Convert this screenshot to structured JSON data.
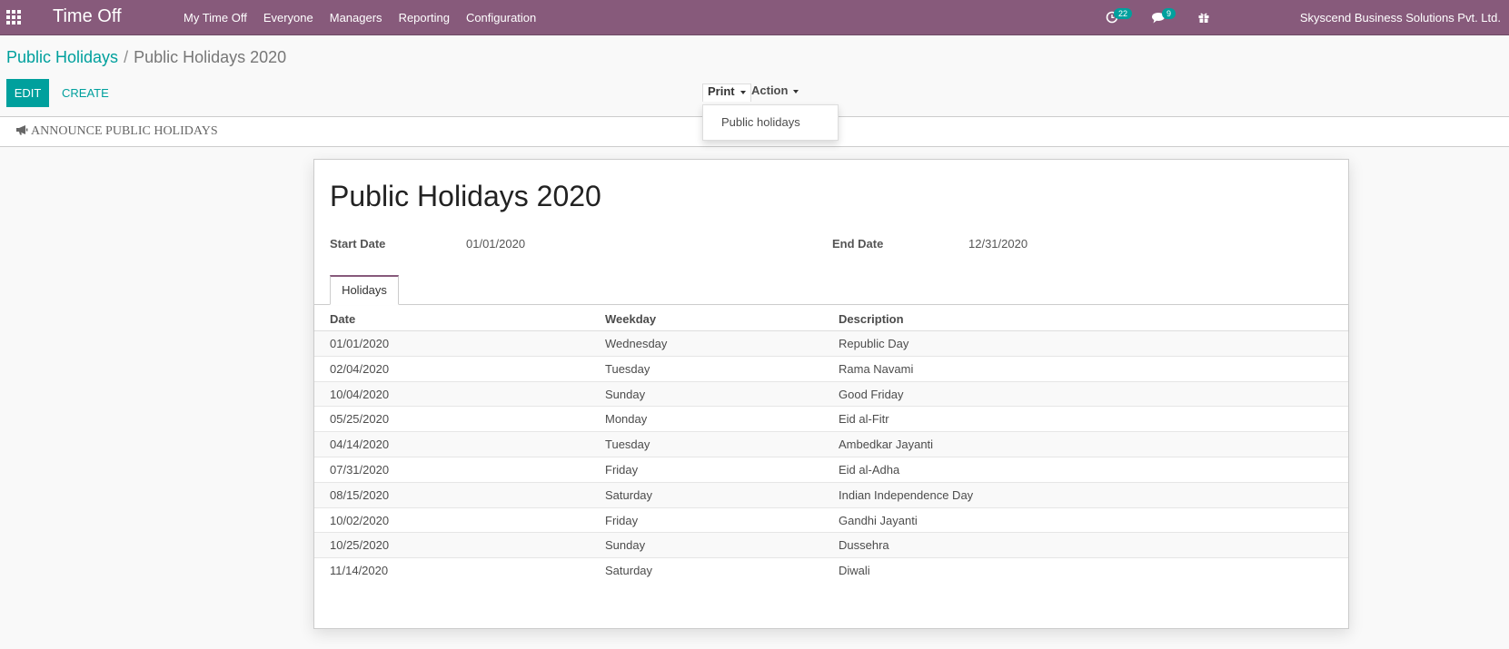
{
  "navbar": {
    "app_title": "Time Off",
    "menu": [
      "My Time Off",
      "Everyone",
      "Managers",
      "Reporting",
      "Configuration"
    ],
    "activity_count": "22",
    "messages_count": "9",
    "company": "Skyscend Business Solutions Pvt. Ltd."
  },
  "breadcrumb": {
    "parent": "Public Holidays",
    "separator": "/",
    "current": "Public Holidays 2020"
  },
  "buttons": {
    "edit": "EDIT",
    "create": "CREATE",
    "print": "Print",
    "action": "Action"
  },
  "print_menu": {
    "items": [
      "Public holidays"
    ]
  },
  "statusbar": {
    "announce": "ANNOUNCE PUBLIC HOLIDAYS"
  },
  "form": {
    "title": "Public Holidays 2020",
    "start_date_label": "Start Date",
    "start_date": "01/01/2020",
    "end_date_label": "End Date",
    "end_date": "12/31/2020",
    "tab": "Holidays"
  },
  "table": {
    "headers": [
      "Date",
      "Weekday",
      "Description"
    ],
    "rows": [
      [
        "01/01/2020",
        "Wednesday",
        "Republic Day"
      ],
      [
        "02/04/2020",
        "Tuesday",
        "Rama Navami"
      ],
      [
        "10/04/2020",
        "Sunday",
        "Good Friday"
      ],
      [
        "05/25/2020",
        "Monday",
        "Eid al-Fitr"
      ],
      [
        "04/14/2020",
        "Tuesday",
        "Ambedkar Jayanti"
      ],
      [
        "07/31/2020",
        "Friday",
        "Eid al-Adha"
      ],
      [
        "08/15/2020",
        "Saturday",
        "Indian Independence Day"
      ],
      [
        "10/02/2020",
        "Friday",
        "Gandhi Jayanti"
      ],
      [
        "10/25/2020",
        "Sunday",
        "Dussehra"
      ],
      [
        "11/14/2020",
        "Saturday",
        "Diwali"
      ]
    ]
  },
  "colors": {
    "navbar": "#875a7b",
    "accent": "#00a09d"
  }
}
